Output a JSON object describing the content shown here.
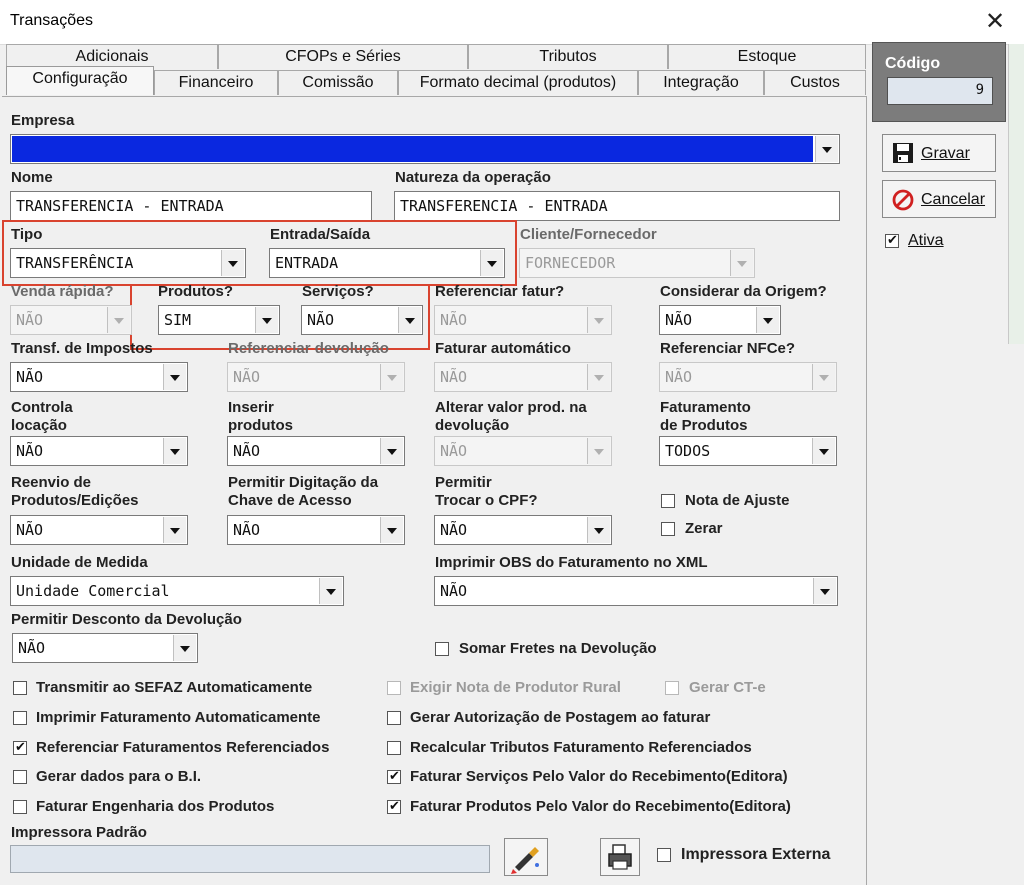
{
  "window": {
    "title": "Transações",
    "close_label": "✕"
  },
  "tabs": {
    "row1": [
      "Adicionais",
      "CFOPs e Séries",
      "Tributos",
      "Estoque"
    ],
    "row2": [
      "Configuração",
      "Financeiro",
      "Comissão",
      "Formato decimal (produtos)",
      "Integração",
      "Custos"
    ],
    "active": "Configuração"
  },
  "side": {
    "codigo_label": "Código",
    "codigo_value": "9",
    "gravar_label": "Gravar",
    "cancelar_label": "Cancelar",
    "ativa_label": "Ativa"
  },
  "form": {
    "empresa_label": "Empresa",
    "nome_label": "Nome",
    "nome_value": "TRANSFERENCIA - ENTRADA",
    "natureza_label": "Natureza da operação",
    "natureza_value": "TRANSFERENCIA - ENTRADA",
    "tipo_label": "Tipo",
    "tipo_value": "TRANSFERÊNCIA",
    "entrada_saida_label": "Entrada/Saída",
    "entrada_saida_value": "ENTRADA",
    "cliente_fornecedor_label": "Cliente/Fornecedor",
    "cliente_fornecedor_value": "FORNECEDOR",
    "venda_rapida_label": "Venda rápida?",
    "venda_rapida_value": "NÃO",
    "produtos_label": "Produtos?",
    "produtos_value": "SIM",
    "servicos_label": "Serviços?",
    "servicos_value": "NÃO",
    "referenciar_fatur_label": "Referenciar fatur?",
    "referenciar_fatur_value": "NÃO",
    "considerar_origem_label": "Considerar da Origem?",
    "considerar_origem_value": "NÃO",
    "transf_impostos_label": "Transf. de Impostos",
    "transf_impostos_value": "NÃO",
    "referenciar_devolucao_label": "Referenciar devolução",
    "referenciar_devolucao_value": "NÃO",
    "faturar_automatico_label": "Faturar automático",
    "faturar_automatico_value": "NÃO",
    "referenciar_nfce_label": "Referenciar NFCe?",
    "referenciar_nfce_value": "NÃO",
    "controla_locacao_label1": "Controla",
    "controla_locacao_label2": "locação",
    "controla_locacao_value": "NÃO",
    "inserir_produtos_label1": "Inserir",
    "inserir_produtos_label2": "produtos",
    "inserir_produtos_value": "NÃO",
    "alterar_valor_label1": "Alterar valor prod. na",
    "alterar_valor_label2": "devolução",
    "alterar_valor_value": "NÃO",
    "faturamento_produtos_label1": "Faturamento",
    "faturamento_produtos_label2": "de Produtos",
    "faturamento_produtos_value": "TODOS",
    "reenvio_label1": "Reenvio de",
    "reenvio_label2": "Produtos/Edições",
    "reenvio_value": "NÃO",
    "permitir_digitacao_label1": "Permitir Digitação da",
    "permitir_digitacao_label2": "Chave de Acesso",
    "permitir_digitacao_value": "NÃO",
    "permitir_trocar_label1": "Permitir",
    "permitir_trocar_label2": "Trocar o CPF?",
    "permitir_trocar_value": "NÃO",
    "nota_ajuste_label": "Nota de Ajuste",
    "zerar_label": "Zerar",
    "unidade_medida_label": "Unidade de Medida",
    "unidade_medida_value": "Unidade Comercial",
    "imprimir_obs_label": "Imprimir OBS do Faturamento no XML",
    "imprimir_obs_value": "NÃO",
    "permitir_desconto_label": "Permitir Desconto da Devolução",
    "permitir_desconto_value": "NÃO",
    "somar_fretes_label": "Somar Fretes na Devolução",
    "impressora_padrao_label": "Impressora Padrão",
    "impressora_externa_label": "Impressora Externa"
  },
  "checks_left": [
    {
      "label": "Transmitir ao SEFAZ Automaticamente",
      "checked": false
    },
    {
      "label": "Imprimir Faturamento Automaticamente",
      "checked": false
    },
    {
      "label": "Referenciar Faturamentos Referenciados",
      "checked": true
    },
    {
      "label": "Gerar dados para o B.I.",
      "checked": false
    },
    {
      "label": "Faturar Engenharia dos Produtos",
      "checked": false
    }
  ],
  "checks_right": [
    {
      "label": "Exigir Nota de Produtor Rural",
      "checked": false,
      "disabled": true
    },
    {
      "label": "Gerar Autorização de Postagem ao faturar",
      "checked": false
    },
    {
      "label": "Recalcular Tributos Faturamento Referenciados",
      "checked": false
    },
    {
      "label": "Faturar Serviços Pelo Valor do Recebimento(Editora)",
      "checked": true
    },
    {
      "label": "Faturar Produtos Pelo Valor do Recebimento(Editora)",
      "checked": true
    }
  ],
  "gerar_cte": {
    "label": "Gerar CT-e",
    "checked": false,
    "disabled": true
  },
  "colors": {
    "empresa_selected_bg": "#0a28e0",
    "highlight_border": "#d9432f"
  }
}
